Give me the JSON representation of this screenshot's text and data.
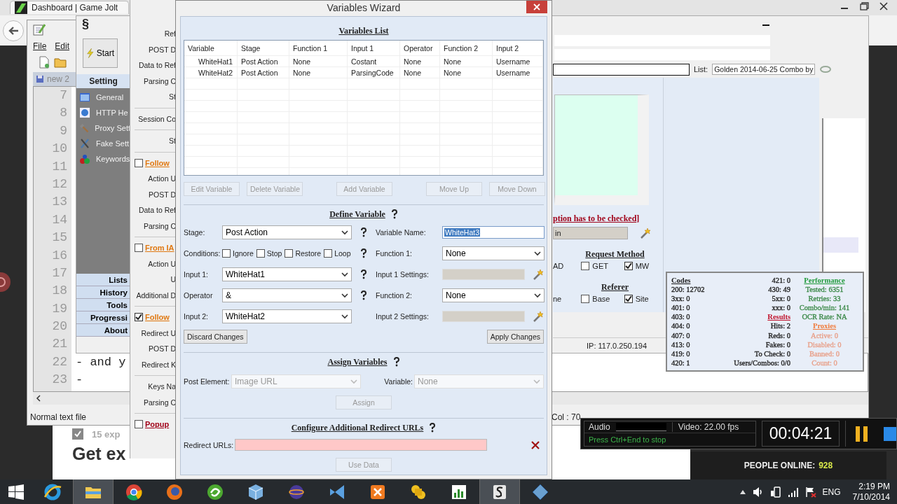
{
  "browser": {
    "tab_title": "Dashboard | Game Jolt",
    "page": {
      "task": {
        "label": "15 exp",
        "checked": true
      },
      "headline": "Get ex",
      "people_online": {
        "label": "PEOPLE ONLINE:",
        "count": "928"
      }
    }
  },
  "notepad": {
    "menu": [
      "File",
      "Edit"
    ],
    "tab": "new 2",
    "lines": [
      {
        "number": "7"
      },
      {
        "number": "8"
      },
      {
        "number": "9"
      },
      {
        "number": "10"
      },
      {
        "number": "11"
      },
      {
        "number": "12"
      },
      {
        "number": "13"
      },
      {
        "number": "14"
      },
      {
        "number": "15"
      },
      {
        "number": "16"
      },
      {
        "number": "17"
      },
      {
        "number": "18"
      },
      {
        "number": "19"
      },
      {
        "number": "20"
      },
      {
        "number": "21"
      },
      {
        "number": "22",
        "text": "- and y"
      },
      {
        "number": "23",
        "text": "-"
      }
    ],
    "status": "Normal text file",
    "position": "Col : 70"
  },
  "app": {
    "title": "§",
    "start_button": "Start",
    "settings_header": "Setting",
    "settings_items": [
      {
        "label": "General",
        "kind": "general"
      },
      {
        "label": "HTTP He",
        "kind": "http"
      },
      {
        "label": "Proxy Sett",
        "kind": "proxy"
      },
      {
        "label": "Fake Sett",
        "kind": "fake"
      },
      {
        "label": "Keywords",
        "kind": "keywords"
      }
    ],
    "nav_buttons": [
      "Lists",
      "History",
      "Tools",
      "Progressi",
      "About"
    ],
    "list_label": "List:",
    "list_value": "Golden 2014-06-25 Combo by",
    "option_note": "ption has to be checked]",
    "login_field": "in",
    "request_method": {
      "title": "Request Method",
      "cut_label": "AD",
      "options": [
        {
          "label": "GET",
          "checked": false
        },
        {
          "label": "MW",
          "checked": true
        }
      ]
    },
    "referer": {
      "title": "Referer",
      "cut_label": "ne",
      "options": [
        {
          "label": "Base",
          "checked": false
        },
        {
          "label": "Site",
          "checked": true
        }
      ]
    },
    "ip": "IP: 117.0.250.194"
  },
  "stats": {
    "columns": [
      [
        {
          "heading": {
            "text": "Codes",
            "color": "#1a1a1a"
          },
          "color": "#222222",
          "values": [
            "200: 12702",
            "3xx: 0",
            "401: 0",
            "403: 0",
            "404: 0",
            "407: 0",
            "413: 0",
            "419: 0",
            "420: 1"
          ]
        }
      ],
      [
        {
          "color": "#222222",
          "values": [
            "421: 0",
            "430: 49",
            "5xx: 0",
            "xxx: 0"
          ]
        },
        {
          "heading": {
            "text": "Results",
            "color": "#c0102a"
          },
          "color": "#222222",
          "values": [
            "Hits: 2",
            "Reds: 0",
            "Fakes: 0",
            "To Check: 0",
            "Users/Combos: 0/0"
          ]
        }
      ],
      [
        {
          "heading": {
            "text": "Performance",
            "color": "#1f9a3a"
          },
          "color": "#3d8a4a",
          "values": [
            "Tested: 6351",
            "Retries: 33",
            "Combo/min: 141",
            "OCR Rate: NA"
          ]
        },
        {
          "heading": {
            "text": "Proxies",
            "color": "#f07a3a"
          },
          "color": "#e8a08a",
          "values": [
            "Active: 0",
            "Disabled: 0",
            "Banned: 0",
            "Count: 0"
          ]
        }
      ]
    ]
  },
  "settings_dialog": {
    "sections": [
      [
        {
          "kind": "label",
          "text": "Ref"
        },
        {
          "kind": "label",
          "text": "POST D"
        },
        {
          "kind": "label",
          "text": "Data to Ref"
        },
        {
          "kind": "label",
          "text": "Parsing C"
        },
        {
          "kind": "label",
          "text": "St"
        }
      ],
      [
        {
          "kind": "label",
          "text": "Session Co"
        }
      ],
      [
        {
          "kind": "label",
          "text": "St"
        }
      ],
      [
        {
          "kind": "check",
          "text": "Follow",
          "checked": false,
          "color": "#e07810"
        },
        {
          "kind": "label",
          "text": "Action U"
        },
        {
          "kind": "label",
          "text": "POST D"
        },
        {
          "kind": "label",
          "text": "Data to Ref"
        },
        {
          "kind": "label",
          "text": "Parsing C"
        }
      ],
      [
        {
          "kind": "check",
          "text": "From IA",
          "checked": false,
          "color": "#e07810"
        },
        {
          "kind": "label",
          "text": "Action U"
        },
        {
          "kind": "label",
          "text": "U"
        },
        {
          "kind": "label",
          "text": "Additional D"
        }
      ],
      [
        {
          "kind": "check",
          "text": "Follow",
          "checked": true,
          "color": "#e07810"
        },
        {
          "kind": "label",
          "text": "Redirect U"
        },
        {
          "kind": "label",
          "text": "POST D"
        },
        {
          "kind": "label",
          "text": "Redirect K"
        }
      ],
      [
        {
          "kind": "label",
          "text": "Keys Na"
        },
        {
          "kind": "label",
          "text": "Parsing C"
        }
      ],
      [
        {
          "kind": "check",
          "text": "Popup",
          "checked": false,
          "color": "#a00018"
        }
      ]
    ]
  },
  "wizard": {
    "title": "Variables Wizard",
    "list": {
      "title": "Variables List",
      "columns": [
        "Variable",
        "Stage",
        "Function 1",
        "Input 1",
        "Operator",
        "Function 2",
        "Input 2"
      ],
      "rows": [
        [
          "WhiteHat1",
          "Post Action",
          "None",
          "Costant",
          "None",
          "None",
          "Username"
        ],
        [
          "WhiteHat2",
          "Post Action",
          "None",
          "ParsingCode",
          "None",
          "None",
          "Username"
        ]
      ],
      "buttons": [
        {
          "label": "Edit Variable",
          "disabled": true
        },
        {
          "label": "Delete Variable",
          "disabled": true
        },
        {
          "label": "Add Variable",
          "disabled": true
        },
        {
          "label": "Move Up",
          "disabled": true
        },
        {
          "label": "Move Down",
          "disabled": true
        }
      ]
    },
    "define": {
      "title": "Define Variable",
      "rows": [
        {
          "left": {
            "kind": "select",
            "label": "Stage:",
            "value": "Post Action"
          },
          "help": true,
          "right": {
            "kind": "text",
            "label": "Variable Name:",
            "value": "WhiteHat3",
            "text_selected": true
          }
        },
        {
          "left": {
            "kind": "checks",
            "label": "Conditions:",
            "options": [
              {
                "label": "Ignore",
                "checked": false
              },
              {
                "label": "Stop",
                "checked": false
              },
              {
                "label": "Restore",
                "checked": false
              },
              {
                "label": "Loop",
                "checked": false
              }
            ]
          },
          "help": true,
          "right": {
            "kind": "select",
            "label": "Function 1:",
            "value": "None"
          }
        },
        {
          "left": {
            "kind": "select",
            "label": "Input 1:",
            "value": "WhiteHat1"
          },
          "help": true,
          "right": {
            "kind": "settings",
            "label": "Input 1 Settings:",
            "disabled": true
          }
        },
        {
          "left": {
            "kind": "select",
            "label": "Operator",
            "value": "&"
          },
          "help": true,
          "right": {
            "kind": "select",
            "label": "Function 2:",
            "value": "None"
          }
        },
        {
          "left": {
            "kind": "select",
            "label": "Input 2:",
            "value": "WhiteHat2"
          },
          "help": false,
          "right": {
            "kind": "settings",
            "label": "Input 2 Settings:",
            "disabled": true
          }
        }
      ],
      "discard": {
        "label": "Discard Changes",
        "disabled": false
      },
      "apply": {
        "label": "Apply Changes",
        "disabled": false
      }
    },
    "assign": {
      "title": "Assign Variables",
      "post_element": {
        "label": "Post Element:",
        "value": "Image URL",
        "disabled": true
      },
      "variable": {
        "label": "Variable:",
        "value": "None",
        "disabled": true
      },
      "button": {
        "label": "Assign",
        "disabled": true
      }
    },
    "redirect": {
      "title": "Configure Additional Redirect URLs",
      "label": "Redirect URLs:",
      "button": {
        "label": "Use Data",
        "disabled": true
      }
    }
  },
  "recorder": {
    "audio_label": "Audio",
    "video": "Video: 22.00 fps",
    "hint": "Press Ctrl+End to stop",
    "time": "00:04:21"
  },
  "taskbar": {
    "apps": [
      {
        "kind": "ie",
        "selected": false
      },
      {
        "kind": "explorer",
        "selected": true
      },
      {
        "kind": "chrome",
        "selected": false
      },
      {
        "kind": "firefox",
        "selected": false
      },
      {
        "kind": "green",
        "selected": false
      },
      {
        "kind": "cube",
        "selected": false
      },
      {
        "kind": "sphere",
        "selected": false
      },
      {
        "kind": "ribbon",
        "selected": false
      },
      {
        "kind": "tile",
        "selected": false
      },
      {
        "kind": "puzzle",
        "selected": false
      },
      {
        "kind": "chart",
        "selected": false
      },
      {
        "kind": "app",
        "selected": true
      },
      {
        "kind": "diamond",
        "selected": false
      }
    ],
    "language": "ENG",
    "time": "2:19 PM",
    "date": "7/10/2014"
  }
}
